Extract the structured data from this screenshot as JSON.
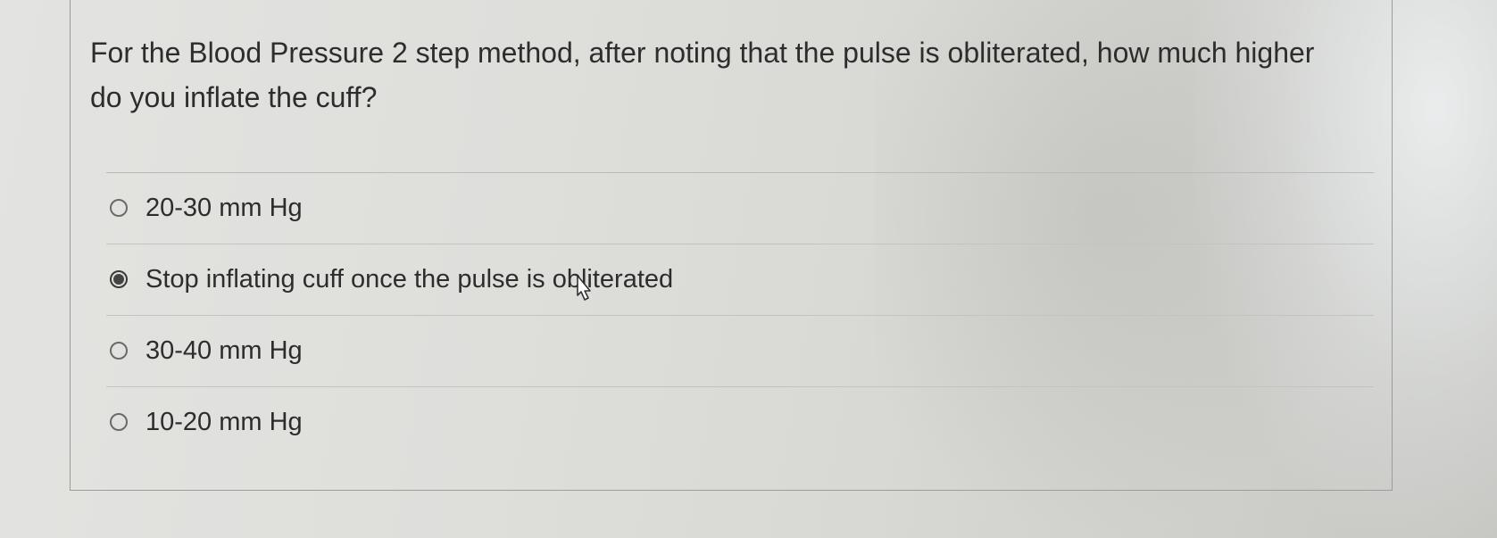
{
  "question": {
    "text": "For the Blood Pressure 2 step method, after noting that the pulse is obliterated, how much higher do you inflate the cuff?"
  },
  "options": [
    {
      "label": "20-30 mm Hg",
      "selected": false
    },
    {
      "label": "Stop inflating cuff once the pulse is obliterated",
      "selected": true
    },
    {
      "label": "30-40 mm Hg",
      "selected": false
    },
    {
      "label": "10-20 mm Hg",
      "selected": false
    }
  ],
  "icons": {
    "cursor": "hand-pointer-cursor-icon"
  }
}
